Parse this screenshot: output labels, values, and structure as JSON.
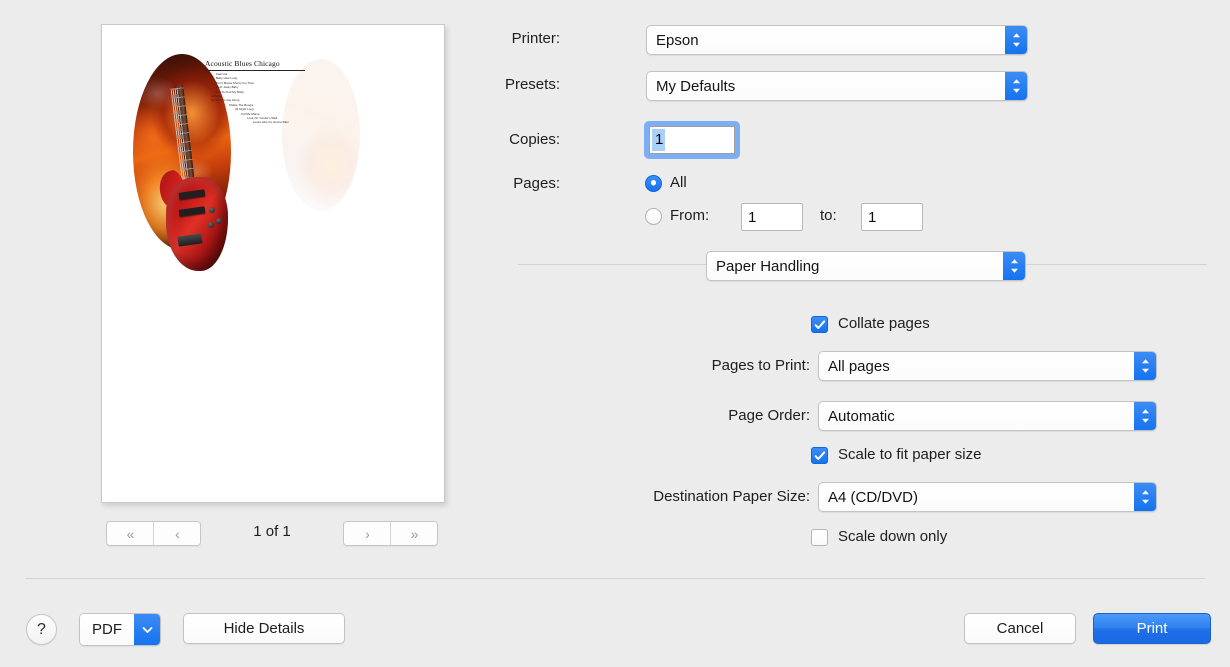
{
  "preview": {
    "album_title": "Acoustic Blues Chicago",
    "tracks": [
      "Fast Life",
      "Baby How Long",
      "Don't Mama Shorty For That",
      "Goin' Away Baby",
      "Got To Find My Baby",
      "Ludella",
      "No Way To Get Along",
      "Shake The Boogie",
      "All Night Long",
      "Tell Me Mama",
      "Look On Yonder's Wall",
      "Looks Like It's Gonna Rain"
    ],
    "nav": {
      "first_label": "«",
      "prev_label": "‹",
      "next_label": "›",
      "last_label": "»",
      "page_indicator": "1 of 1"
    }
  },
  "settings": {
    "printer_label": "Printer:",
    "printer_value": "Epson",
    "presets_label": "Presets:",
    "presets_value": "My Defaults",
    "copies_label": "Copies:",
    "copies_value": "1",
    "pages_label": "Pages:",
    "pages_all_label": "All",
    "pages_from_label": "From:",
    "pages_from_value": "1",
    "pages_to_label": "to:",
    "pages_to_value": "1",
    "pane_value": "Paper Handling"
  },
  "paper_handling": {
    "collate_label": "Collate pages",
    "collate_checked": true,
    "pages_to_print_label": "Pages to Print:",
    "pages_to_print_value": "All pages",
    "page_order_label": "Page Order:",
    "page_order_value": "Automatic",
    "scale_to_fit_label": "Scale to fit paper size",
    "scale_to_fit_checked": true,
    "destination_paper_size_label": "Destination Paper Size:",
    "destination_paper_size_value": "A4 (CD/DVD)",
    "scale_down_only_label": "Scale down only",
    "scale_down_only_checked": false
  },
  "footer": {
    "help_label": "?",
    "pdf_label": "PDF",
    "hide_details_label": "Hide Details",
    "cancel_label": "Cancel",
    "print_label": "Print"
  },
  "colors": {
    "accent_blue": "#1373ef",
    "window_background": "#ececec",
    "default_button_blue": "#2f7eee"
  }
}
